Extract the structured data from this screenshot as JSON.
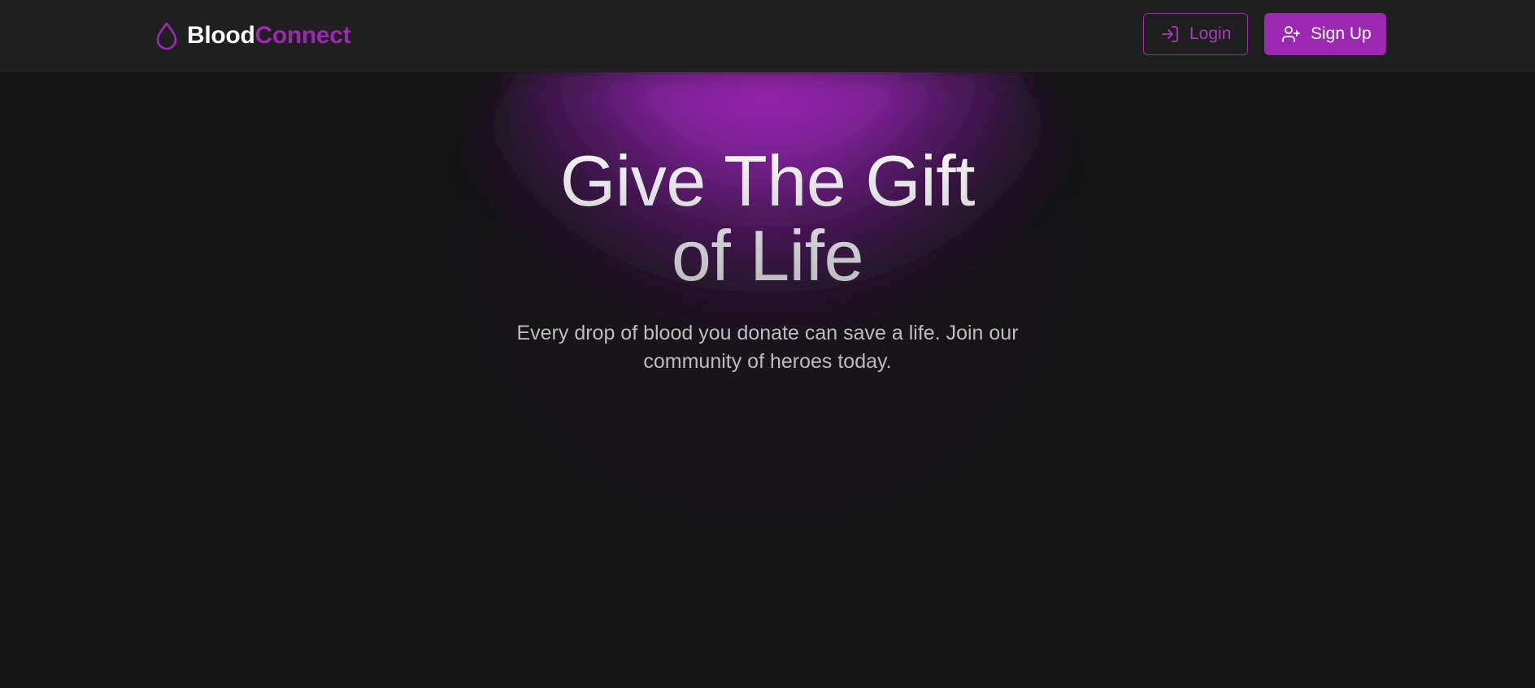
{
  "brand": {
    "name_first": "Blood",
    "name_second": "Connect",
    "icon": "blood-drop-icon"
  },
  "nav": {
    "login_label": "Login",
    "login_icon": "login-icon",
    "signup_label": "Sign Up",
    "signup_icon": "user-plus-icon"
  },
  "hero": {
    "title_line1": "Give The Gift",
    "title_line2": "of Life",
    "subtitle": "Every drop of blood you donate can save a life. Join our community of heroes today."
  },
  "colors": {
    "accent": "#9c27b0",
    "navbar_bg": "#1f1f1f",
    "page_bg": "#141414",
    "text_muted": "#bdbdbd"
  }
}
